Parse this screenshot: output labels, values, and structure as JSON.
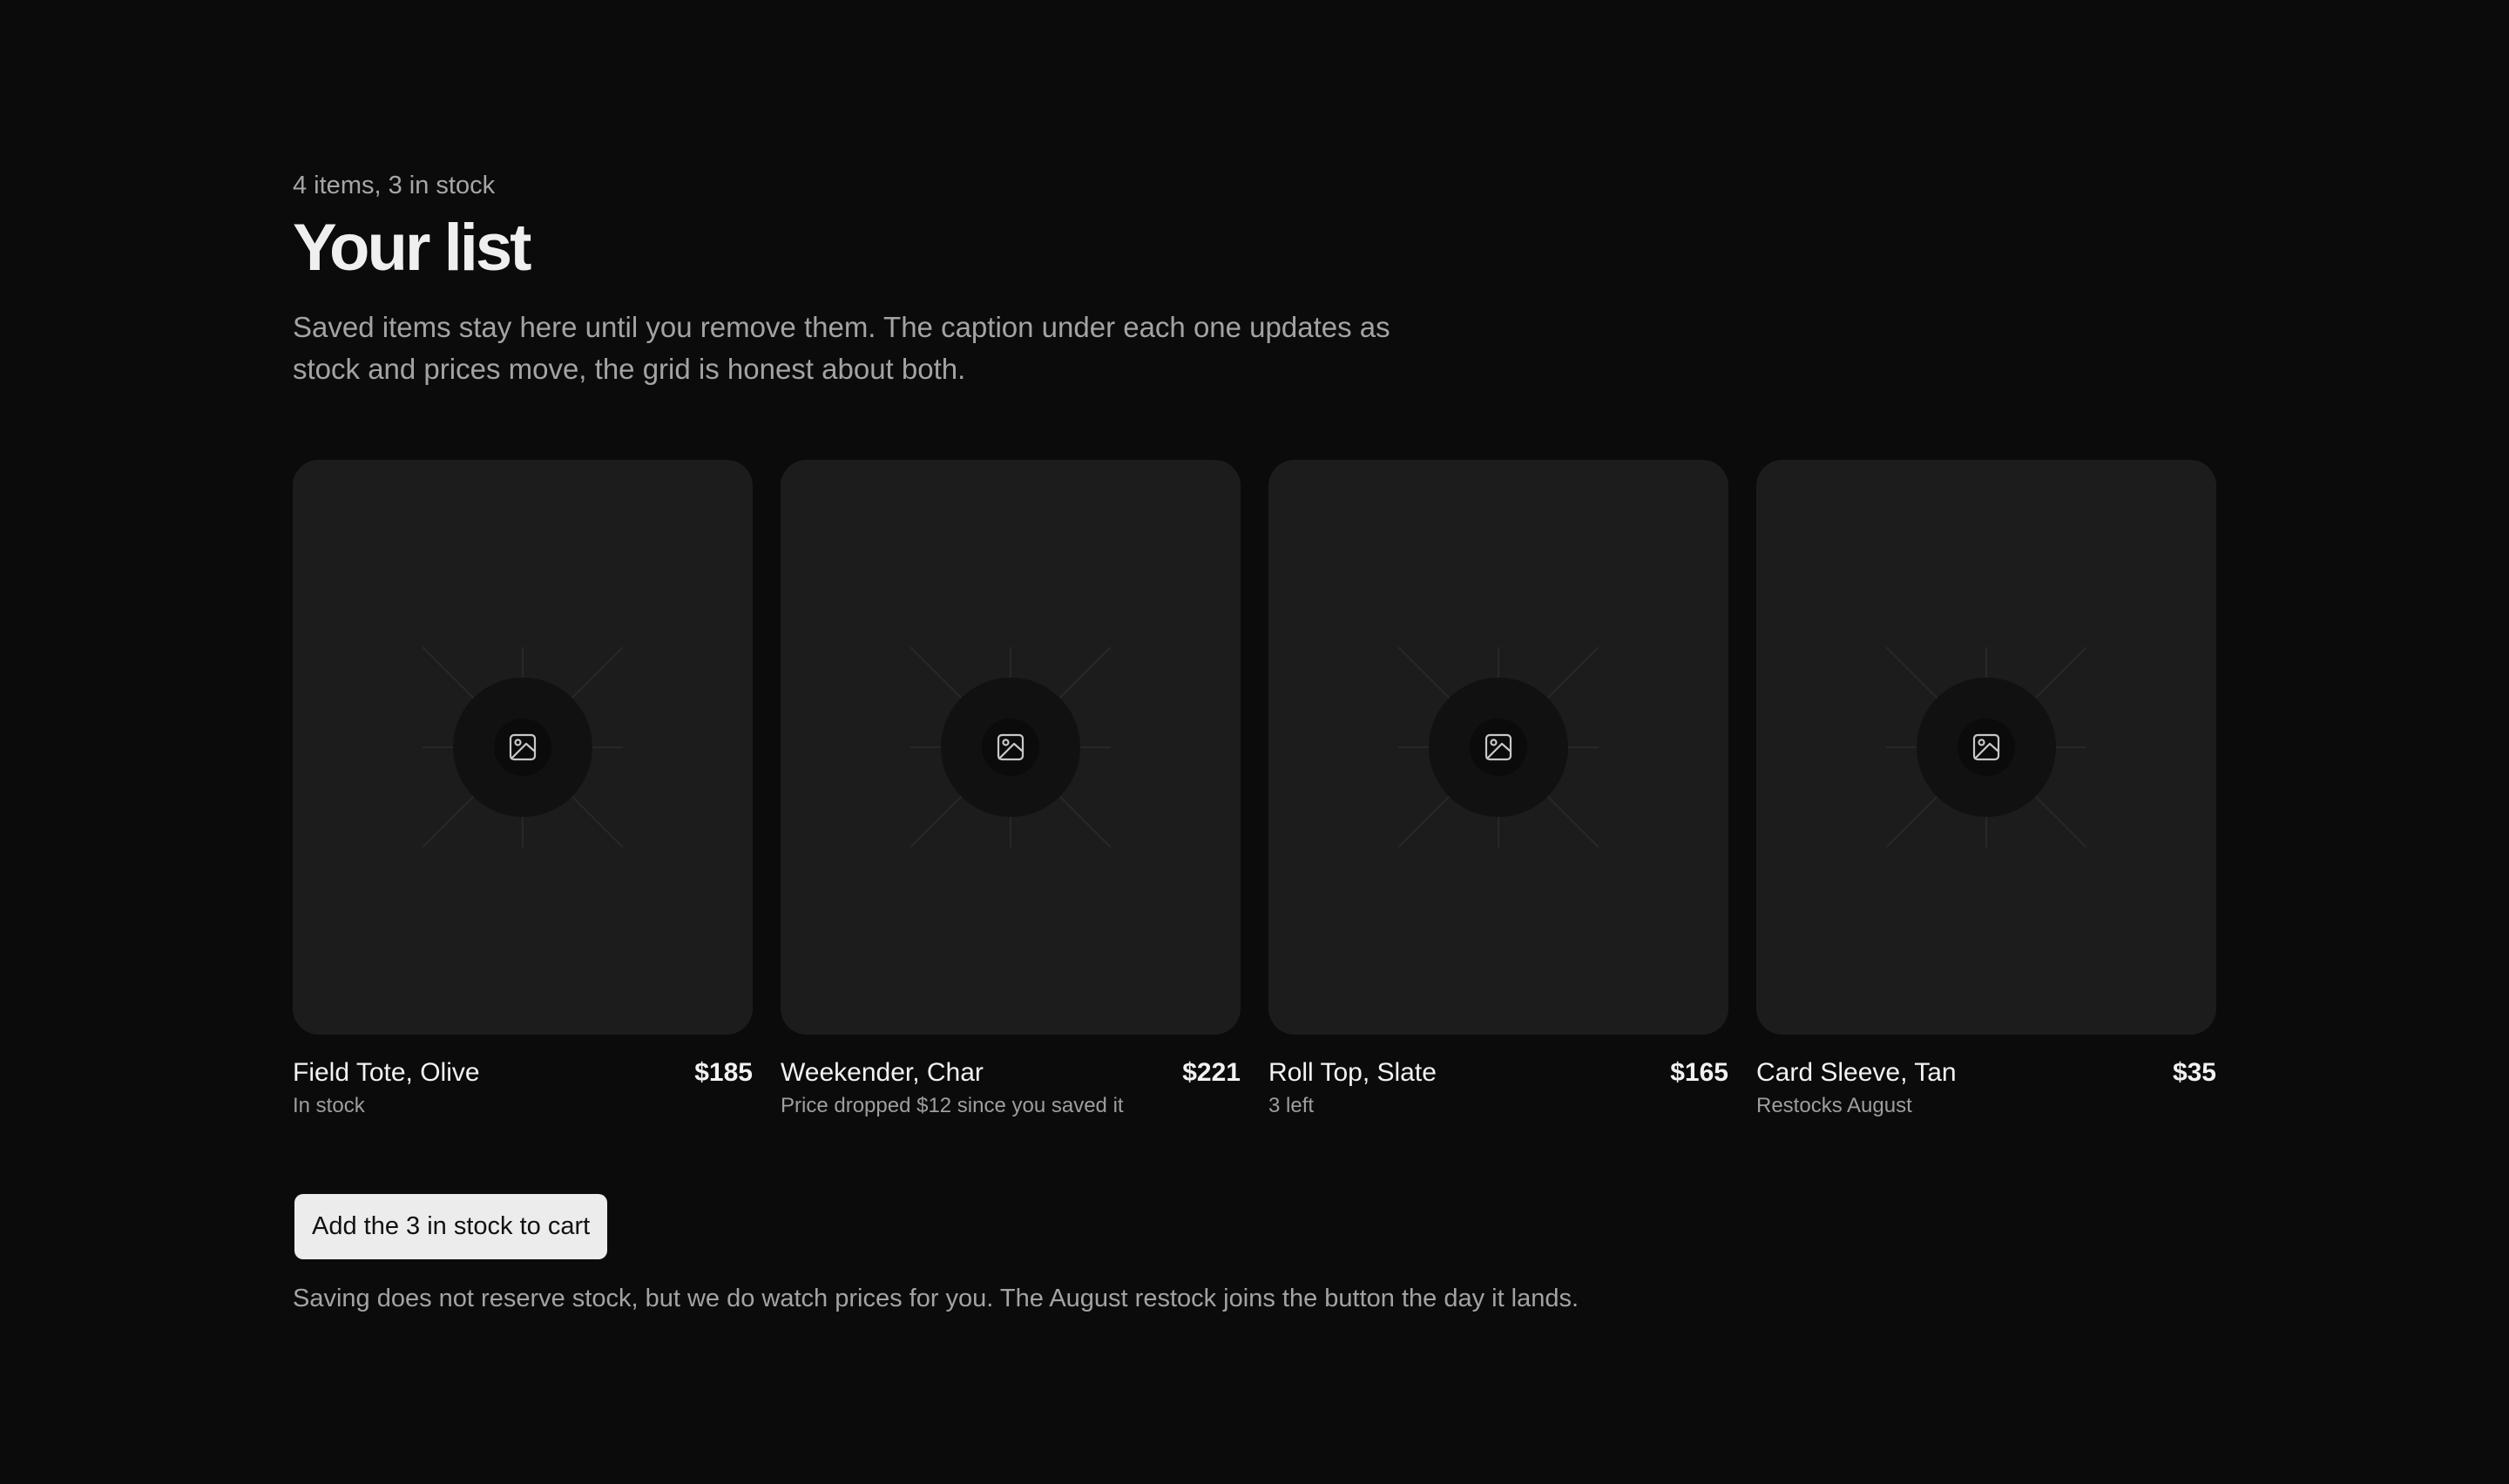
{
  "header": {
    "eyebrow": "4 items, 3 in stock",
    "title": "Your list",
    "intro": "Saved items stay here until you remove them. The caption under each one updates as stock and prices move, the grid is honest about both."
  },
  "items": [
    {
      "name": "Field Tote, Olive",
      "price": "$185",
      "status": "In stock",
      "icon": "image-placeholder-icon"
    },
    {
      "name": "Weekender, Char",
      "price": "$221",
      "status": "Price dropped $12 since you saved it",
      "icon": "image-placeholder-icon"
    },
    {
      "name": "Roll Top, Slate",
      "price": "$165",
      "status": "3 left",
      "icon": "image-placeholder-icon"
    },
    {
      "name": "Card Sleeve, Tan",
      "price": "$35",
      "status": "Restocks August",
      "icon": "image-placeholder-icon"
    }
  ],
  "cta": {
    "label": "Add the 3 in stock to cart"
  },
  "footnote": "Saving does not reserve stock, but we do watch prices for you. The August restock joins the button the day it lands.",
  "colors": {
    "background": "#0b0b0b",
    "card": "#1c1c1c",
    "button": "#ececec",
    "muted_text": "#a3a3a3"
  }
}
